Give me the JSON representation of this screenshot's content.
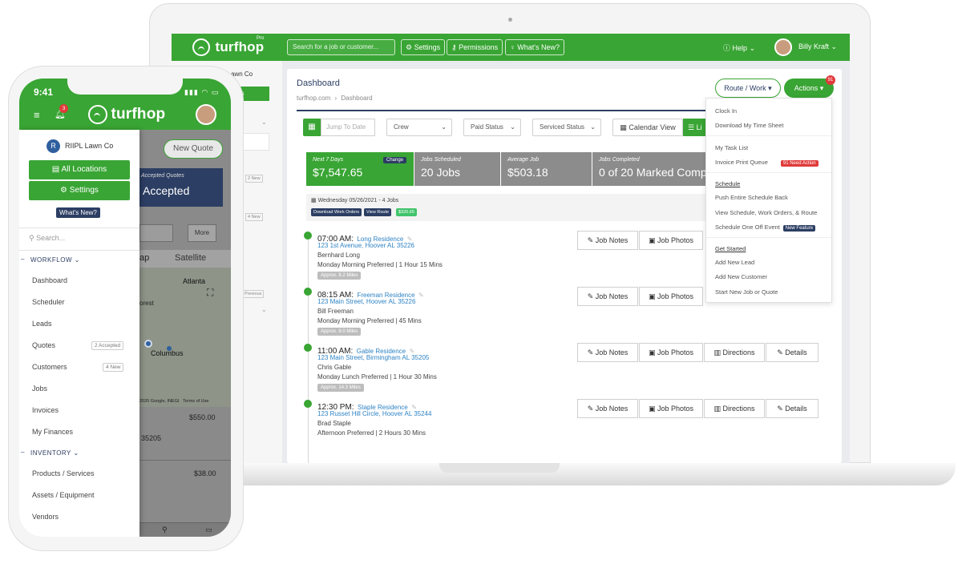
{
  "laptop": {
    "brand": "turfhop",
    "brand_tag": "Pro",
    "search_placeholder": "Search for a job or customer...",
    "nav_settings": "Settings",
    "nav_permissions": "Permissions",
    "nav_whats_new": "What's New?",
    "help": "Help",
    "user_name": "Billy Kraft",
    "side_company_partial": "awn Co",
    "side_button_partial": "ns",
    "side_badge_2": "2 New",
    "side_badge_4": "4 New",
    "side_badge_prev": "Previous",
    "page_title": "Dashboard",
    "breadcrumb_root": "turfhop.com",
    "breadcrumb_sep": "›",
    "breadcrumb_current": "Dashboard",
    "route_work": "Route / Work",
    "actions": "Actions",
    "actions_badge": "91",
    "filters": {
      "date_placeholder": "Jump To Date",
      "crew": "Crew",
      "paid_status": "Paid Status",
      "serviced_status": "Serviced Status",
      "calendar_view": "Calendar View",
      "list_view_partial": "Li"
    },
    "stats": [
      {
        "label": "Next 7 Days",
        "value": "$7,547.65",
        "tag": "Change"
      },
      {
        "label": "Jobs Scheduled",
        "value": "20 Jobs"
      },
      {
        "label": "Average Job",
        "value": "$503.18"
      },
      {
        "label": "Jobs Completed",
        "value": "0 of 20 Marked Complete"
      }
    ],
    "day_header": "Wednesday 05/26/2021 - 4 Jobs",
    "day_buttons": {
      "download": "Download Work Orders",
      "view_route": "View Route",
      "amount": "$320.65"
    },
    "jobs": [
      {
        "time": "07:00 AM:",
        "name": "Long Residence",
        "address": "123 1st Avenue, Hoover AL 35226",
        "customer": "Bernhard Long",
        "pref": "Monday Morning Preferred | 1 Hour 15 Mins",
        "badge": "Approx. 8.2 Miles"
      },
      {
        "time": "08:15 AM:",
        "name": "Freeman Residence",
        "address": "123 Main Street, Hoover AL 35226",
        "customer": "Bill Freeman",
        "pref": "Monday Morning Preferred | 45 Mins",
        "badge": "Approx. 8.0 Miles"
      },
      {
        "time": "11:00 AM:",
        "name": "Gable Residence",
        "address": "123 Main Street, Birmingham AL 35205",
        "customer": "Chris Gable",
        "pref": "Monday Lunch Preferred | 1 Hour 30 Mins",
        "badge": "Approx. 14.3 Miles"
      },
      {
        "time": "12:30 PM:",
        "name": "Staple Residence",
        "address": "123 Russet Hill Circle, Hoover AL 35244",
        "customer": "Brad Staple",
        "pref": "Afternoon Preferred | 2 Hours 30 Mins",
        "badge": ""
      }
    ],
    "job_actions": {
      "notes": "Job Notes",
      "photos": "Job Photos",
      "directions": "Directions",
      "details": "Details"
    },
    "dropdown": {
      "clock_in": "Clock In",
      "download_timesheet": "Download My Time Sheet",
      "task_list": "My Task List",
      "invoice_queue": "Invoice Print Queue",
      "invoice_badge": "91 Need Action",
      "schedule_head": "Schedule",
      "push_schedule": "Push Entire Schedule Back",
      "view_schedule": "View Schedule, Work Orders, & Route",
      "one_off": "Schedule One Off Event",
      "one_off_badge": "New Feature",
      "started_head": "Get Started",
      "add_lead": "Add New Lead",
      "add_customer": "Add New Customer",
      "start_job": "Start New Job or Quote"
    },
    "colors": {
      "green": "#39a534",
      "navy": "#2c3e63",
      "gray_stat": "#8c8c8c",
      "red": "#e03a3a"
    }
  },
  "phone": {
    "time": "9:41",
    "notif_count": "3",
    "brand": "turfhop",
    "company": "RIIPL Lawn Co",
    "company_initial": "R",
    "all_locations": "All Locations",
    "settings": "Settings",
    "whats_new": "What's New?",
    "search_placeholder": "Search...",
    "workflow": "WORKFLOW",
    "inventory": "INVENTORY",
    "nav": [
      "Dashboard",
      "Scheduler",
      "Leads",
      "Quotes",
      "Customers",
      "Jobs",
      "Invoices",
      "My Finances"
    ],
    "inventory_nav": [
      "Products / Services",
      "Assets / Equipment",
      "Vendors"
    ],
    "quotes_badge": "2 Accepted",
    "customers_badge": "4 New",
    "behind": {
      "new_quote": "New Quote",
      "accepted_label": "Accepted Quotes",
      "accepted_value": "Accepted",
      "more": "More",
      "map_tab": "ap",
      "satellite_tab": "Satellite",
      "city_atlanta": "Atlanta",
      "city_columbus": "Columbus",
      "city_forest": "orest",
      "map_credit": "2020 Google, INEGI",
      "map_terms": "Terms of Use",
      "amount1": "$550.00",
      "zip": "35205",
      "amount2": "$38.00"
    }
  }
}
